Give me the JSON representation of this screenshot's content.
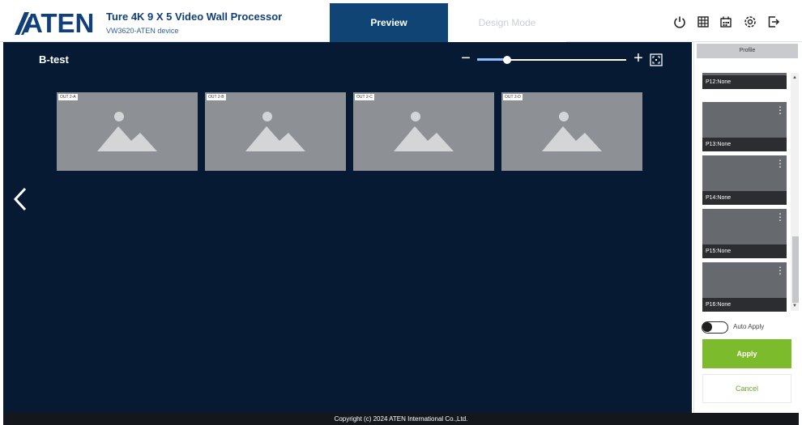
{
  "header": {
    "logo_text": "ATEN",
    "title": "Ture 4K 9 X 5 Video Wall Processor",
    "subtitle": "VW3620-ATEN device",
    "tabs": [
      {
        "label": "Preview",
        "active": true
      },
      {
        "label": "Design Mode",
        "active": false
      }
    ],
    "icons": [
      "power-icon",
      "grid-icon",
      "calendar-icon",
      "settings-icon",
      "logout-icon"
    ],
    "accent": "#0f4475",
    "brand_color": "#103f7a"
  },
  "main": {
    "wall_name": "B-test",
    "zoom_level": 0.2,
    "outputs": [
      {
        "label": "OUT 2-A"
      },
      {
        "label": "OUT 2-B"
      },
      {
        "label": "OUT 2-C"
      },
      {
        "label": "OUT 2-D"
      }
    ],
    "background": "#061b33"
  },
  "panel": {
    "tab_label": "Profile",
    "profiles": [
      {
        "label": "P12:None"
      },
      {
        "label": "P13:None"
      },
      {
        "label": "P14:None"
      },
      {
        "label": "P15:None"
      },
      {
        "label": "P16:None"
      }
    ],
    "auto_apply_label": "Auto Apply",
    "auto_apply_on": false,
    "apply_label": "Apply",
    "cancel_label": "Cancel",
    "apply_color": "#7cbc2c"
  },
  "footer": {
    "copyright": "Copyright (c) 2024 ATEN International Co.,Ltd."
  }
}
